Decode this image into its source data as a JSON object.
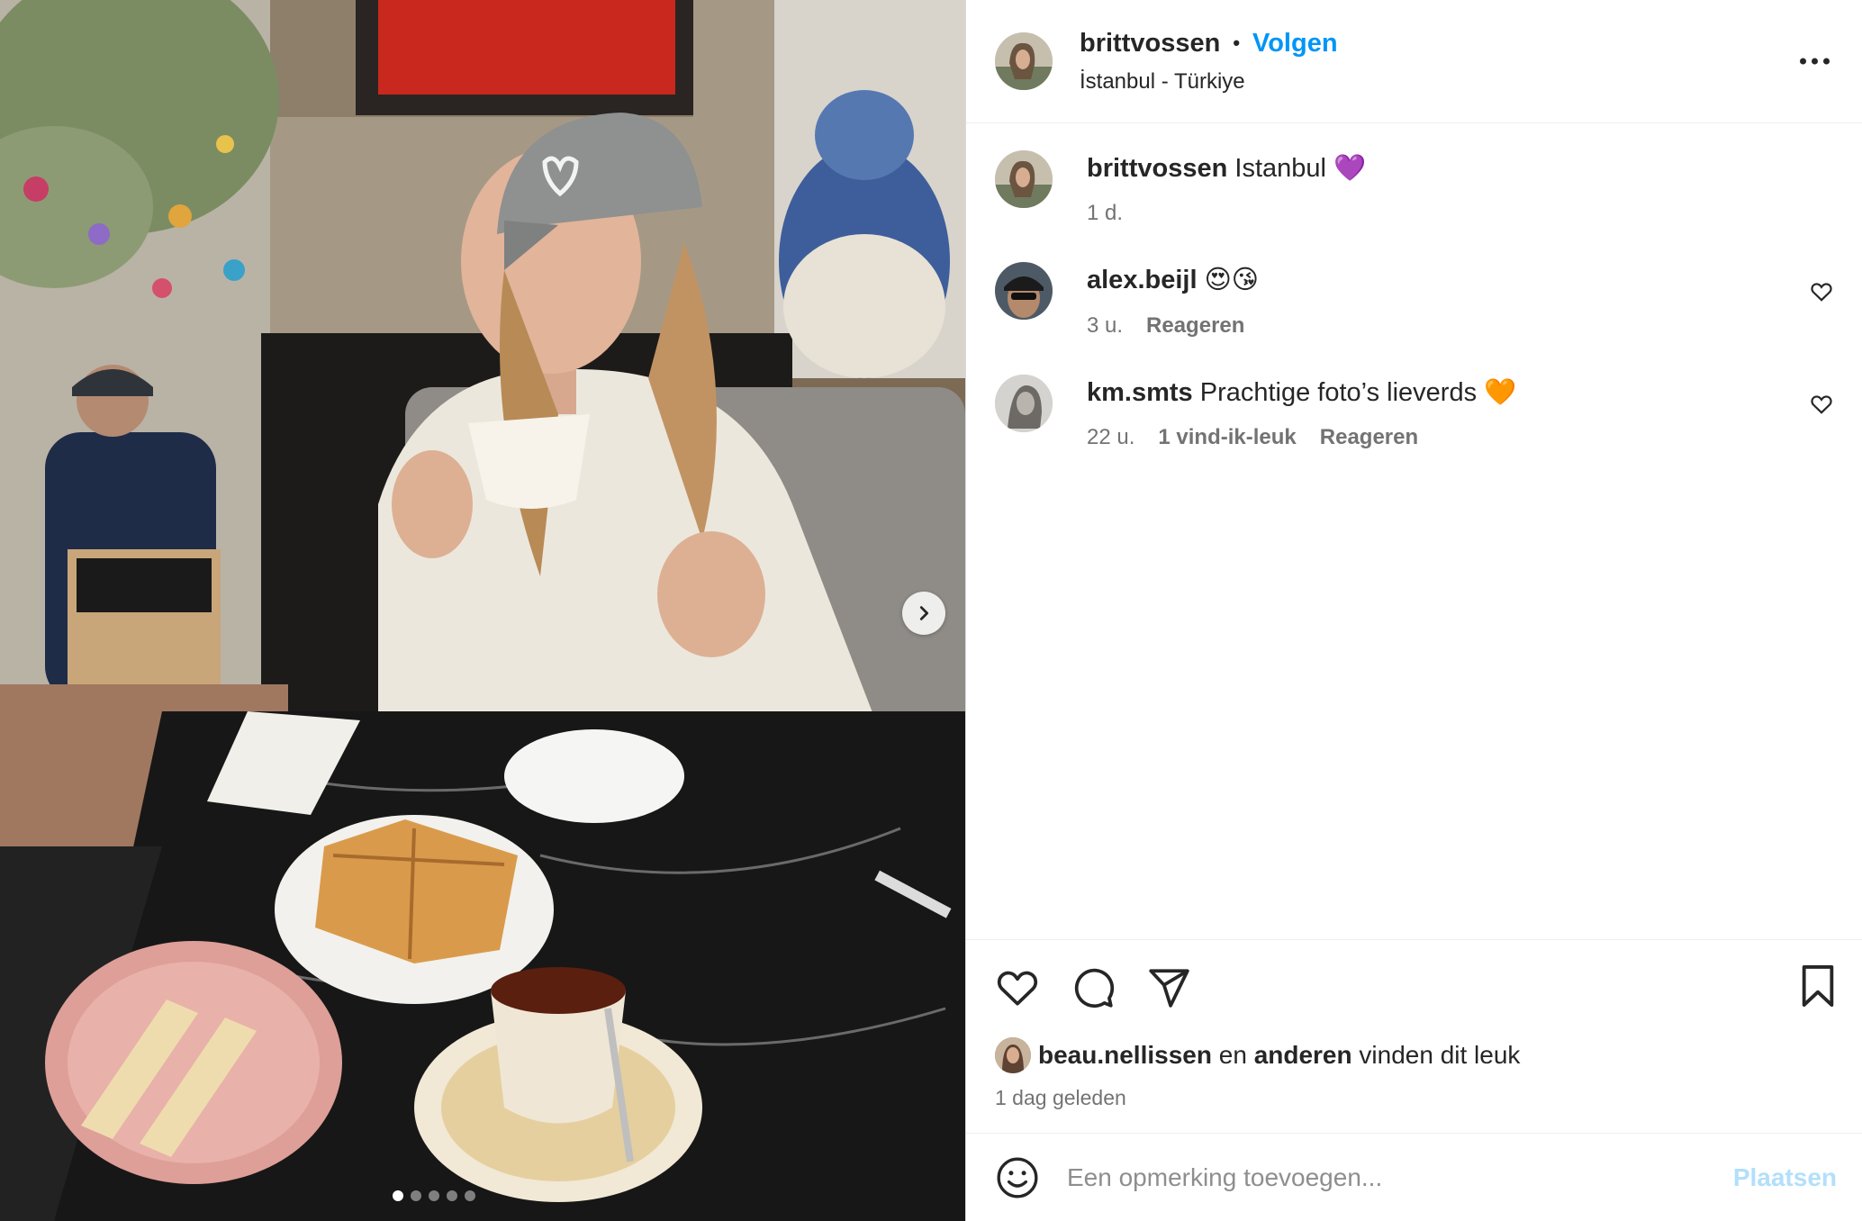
{
  "post": {
    "author": "brittvossen",
    "separator": "•",
    "follow_label": "Volgen",
    "location": "İstanbul - Türkiye",
    "more_icon": "more-horizontal-icon"
  },
  "caption": {
    "username": "brittvossen",
    "text": "Istanbul 💜",
    "time": "1 d."
  },
  "comments": [
    {
      "username": "alex.beijl",
      "text": "😍😘",
      "time": "3 u.",
      "likes": "",
      "reply_label": "Reageren"
    },
    {
      "username": "km.smts",
      "text": "Prachtige foto’s lieverds 🧡",
      "time": "22 u.",
      "likes": "1 vind-ik-leuk",
      "reply_label": "Reageren"
    }
  ],
  "likes_line": {
    "user": "beau.nellissen",
    "mid": "en",
    "others": "anderen",
    "end": "vinden dit leuk"
  },
  "posted_ago": "1 dag geleden",
  "add_comment": {
    "placeholder": "Een opmerking toevoegen...",
    "post_label": "Plaatsen"
  },
  "carousel": {
    "count": 5,
    "active_index": 0
  },
  "colors": {
    "follow_blue": "#0095f6",
    "post_disabled": "#b2dffc",
    "muted_text": "#737373"
  }
}
